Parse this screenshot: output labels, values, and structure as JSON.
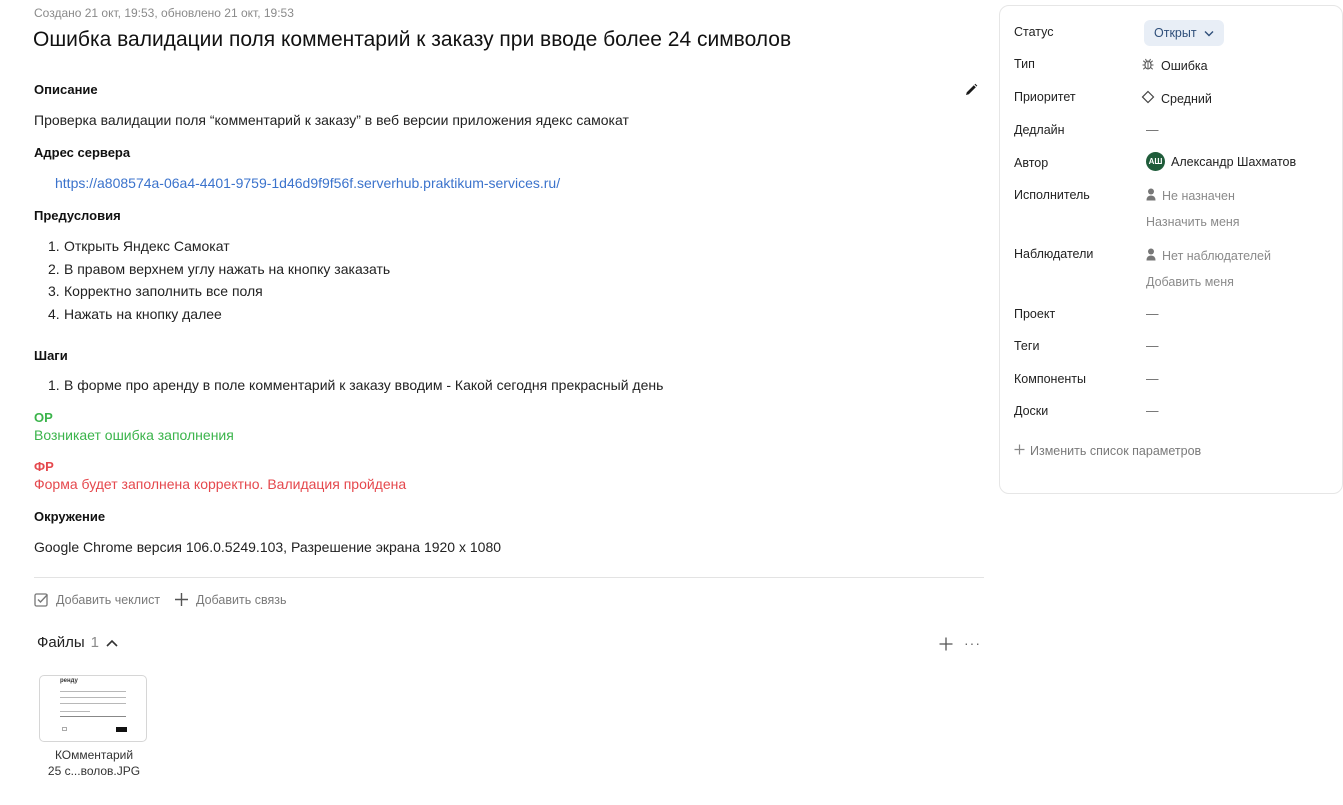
{
  "meta": "Создано 21 окт, 19:53, обновлено 21 окт, 19:53",
  "title": "Ошибка валидации поля комментарий к заказу при вводе более 24 символов",
  "description": {
    "heading": "Описание",
    "text": "Проверка валидации поля “комментарий к заказу” в веб версии приложения ядекс самокат"
  },
  "server": {
    "heading": "Адрес сервера",
    "url": "https://a808574a-06a4-4401-9759-1d46d9f9f56f.serverhub.praktikum-services.ru/"
  },
  "preconditions": {
    "heading": "Предусловия",
    "items": [
      {
        "num": "1.",
        "text": "Открыть Яндекс Самокат"
      },
      {
        "num": "2.",
        "text": "В правом верхнем углу нажать на кнопку заказать"
      },
      {
        "num": "3.",
        "text": "Корректно заполнить все поля"
      },
      {
        "num": "4.",
        "text": "Нажать на кнопку далее"
      }
    ]
  },
  "steps": {
    "heading": "Шаги",
    "items": [
      {
        "num": "1.",
        "text": "В форме про аренду в поле комментарий к заказу вводим - Какой сегодня прекрасный день"
      }
    ]
  },
  "expected": {
    "heading": "ОР",
    "text": "Возникает ошибка заполнения",
    "color": "#3bb44b"
  },
  "actual": {
    "heading": "ФР",
    "text": "Форма будет заполнена корректно. Валидация пройдена",
    "color": "#e5484d"
  },
  "environment": {
    "heading": "Окружение",
    "text": "Google Chrome версия 106.0.5249.103, Разрешение экрана 1920 х 1080"
  },
  "actions": {
    "add_checklist": "Добавить чеклист",
    "add_link": "Добавить связь"
  },
  "files": {
    "heading": "Файлы",
    "count": "1",
    "items": [
      {
        "name_line1": "КОмментарий",
        "name_line2": "25 с...волов.JPG",
        "preview_title": "ренду"
      }
    ]
  },
  "sidebar": {
    "status": {
      "label": "Статус",
      "value": "Открыт"
    },
    "type": {
      "label": "Тип",
      "value": "Ошибка",
      "icon": "bug-icon"
    },
    "priority": {
      "label": "Приоритет",
      "value": "Средний",
      "icon": "diamond-icon"
    },
    "deadline": {
      "label": "Дедлайн",
      "value": "—"
    },
    "author": {
      "label": "Автор",
      "initials": "АШ",
      "value": "Александр Шахматов"
    },
    "assignee": {
      "label": "Исполнитель",
      "value": "Не назначен",
      "action": "Назначить меня"
    },
    "watchers": {
      "label": "Наблюдатели",
      "value": "Нет наблюдателей",
      "action": "Добавить меня"
    },
    "project": {
      "label": "Проект",
      "value": "—"
    },
    "tags": {
      "label": "Теги",
      "value": "—"
    },
    "components": {
      "label": "Компоненты",
      "value": "—"
    },
    "boards": {
      "label": "Доски",
      "value": "—"
    },
    "change_params": "Изменить список параметров"
  },
  "colors": {
    "link": "#3b73cc",
    "status_bg": "#e8eef6",
    "avatar_bg": "#1f5c3a"
  }
}
